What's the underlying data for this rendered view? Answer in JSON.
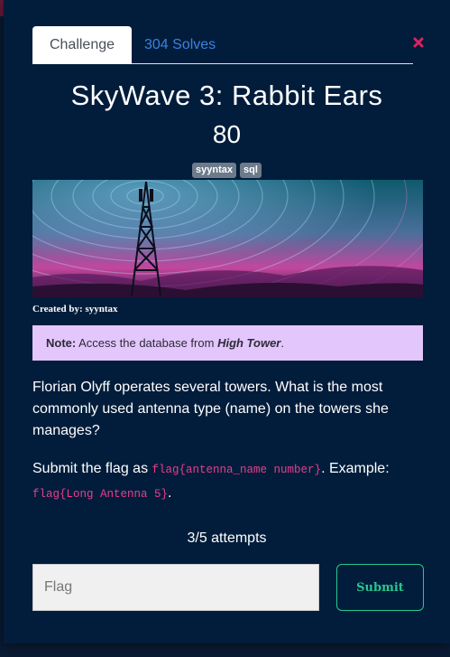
{
  "tabs": [
    {
      "label": "Challenge"
    },
    {
      "label": "304 Solves"
    }
  ],
  "challenge": {
    "title": "SkyWave 3: Rabbit Ears",
    "points": "80",
    "tags": [
      "syyntax",
      "sql"
    ],
    "creator": "Created by: syyntax"
  },
  "note": {
    "label": "Note:",
    "text": "Access the database from",
    "emphasis": "High Tower",
    "end": "."
  },
  "question": "Florian Olyff operates several towers. What is the most commonly used antenna type (name) on the towers she manages?",
  "submit_instructions": {
    "prefix": "Submit the flag as",
    "format_code": "flag{antenna_name number}",
    "middle": ". Example:",
    "example_code": "flag{Long Antenna 5}",
    "end": "."
  },
  "attempts": "3/5 attempts",
  "flag_input": {
    "placeholder": "Flag",
    "value": ""
  },
  "submit_label": "Submit",
  "colors": {
    "modal_bg": "#021d3b",
    "accent_link": "#3b82e0",
    "submit_green": "#28c78e",
    "note_bg": "#e3c6fb",
    "code_pink": "#e83e8c",
    "close_red": "#e2215f"
  },
  "icons": {
    "close": "close-x-icon",
    "banner": "radio-tower-banner"
  }
}
